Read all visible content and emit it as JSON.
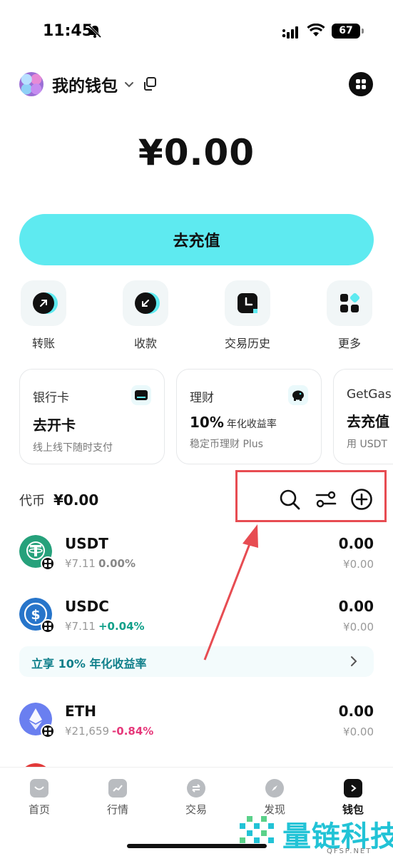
{
  "status_bar": {
    "time": "11:45",
    "battery": "67"
  },
  "header": {
    "wallet_name": "我的钱包"
  },
  "balance": "¥0.00",
  "deposit_button": "去充值",
  "quick_actions": [
    {
      "label": "转账",
      "icon": "send-arrow-icon"
    },
    {
      "label": "收款",
      "icon": "receive-arrow-icon"
    },
    {
      "label": "交易历史",
      "icon": "history-icon"
    },
    {
      "label": "更多",
      "icon": "more-grid-icon"
    }
  ],
  "cards": [
    {
      "title": "银行卡",
      "main": "去开卡",
      "main_suffix": "",
      "sub": "线上线下随时支付",
      "icon": "bank-card-icon"
    },
    {
      "title": "理财",
      "main": "10%",
      "main_suffix": "年化收益率",
      "sub": "稳定币理财 Plus",
      "icon": "piggy-bank-icon"
    },
    {
      "title": "GetGas",
      "main": "去充值",
      "main_suffix": "",
      "sub": "用 USDT"
    }
  ],
  "tokens_section": {
    "label": "代币",
    "total": "¥0.00"
  },
  "tokens": [
    {
      "symbol": "USDT",
      "price": "¥7.11",
      "change": "0.00%",
      "amount": "0.00",
      "fiat": "¥0.00",
      "color": "#26a17b"
    },
    {
      "symbol": "USDC",
      "price": "¥7.11",
      "change": "+0.04%",
      "amount": "0.00",
      "fiat": "¥0.00",
      "color": "#2775ca"
    },
    {
      "symbol": "ETH",
      "price": "¥21,659",
      "change": "-0.84%",
      "amount": "0.00",
      "fiat": "¥0.00",
      "color": "#6a7ff0"
    }
  ],
  "yield_banner": "立享 10% 年化收益率",
  "tabs": [
    {
      "label": "首页",
      "icon": "home-icon"
    },
    {
      "label": "行情",
      "icon": "market-icon"
    },
    {
      "label": "交易",
      "icon": "swap-icon"
    },
    {
      "label": "发现",
      "icon": "discover-icon"
    },
    {
      "label": "钱包",
      "icon": "wallet-icon",
      "active": true
    }
  ],
  "watermark": {
    "text": "量链科技",
    "sub": "QFSP.NET"
  },
  "colors": {
    "accent": "#5eeaf0",
    "up": "#11a08a",
    "down": "#e6387a",
    "annotation": "#e74c52"
  }
}
